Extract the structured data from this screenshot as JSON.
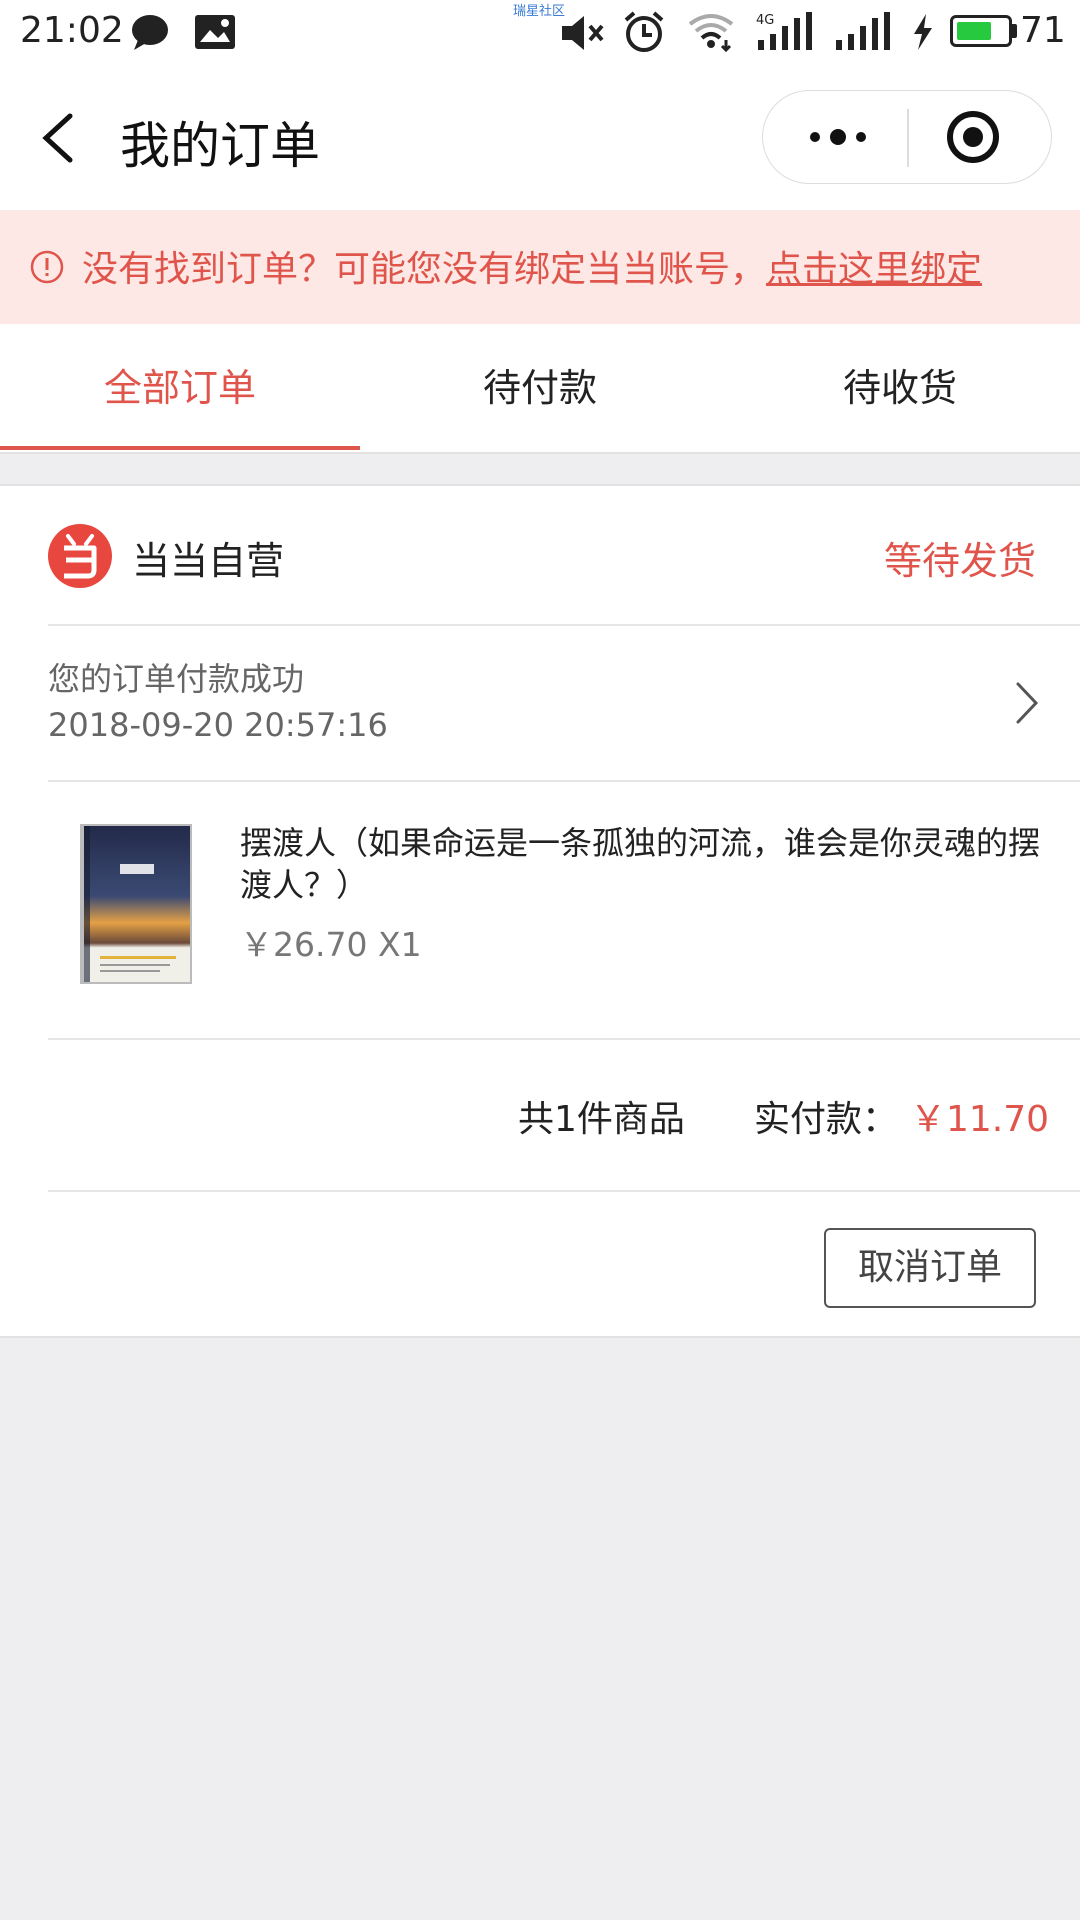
{
  "status_bar": {
    "time": "21:02",
    "watermark": "瑞星社区",
    "battery_percent": "71",
    "battery_level": 0.71,
    "icons": [
      "message-icon",
      "image-icon",
      "mute-icon",
      "alarm-icon",
      "wifi-icon",
      "signal-4g-icon",
      "signal-icon",
      "charging-icon",
      "battery-icon"
    ]
  },
  "nav": {
    "title": "我的订单",
    "back_icon": "chevron-left-icon",
    "more_icon": "more-dots-icon",
    "close_icon": "target-close-icon"
  },
  "notice": {
    "text": "没有找到订单？可能您没有绑定当当账号，",
    "link": "点击这里绑定",
    "icon": "alert-circle-icon"
  },
  "tabs": [
    {
      "label": "全部订单",
      "active": true
    },
    {
      "label": "待付款",
      "active": false
    },
    {
      "label": "待收货",
      "active": false
    }
  ],
  "order": {
    "shop_name": "当当自营",
    "status": "等待发货",
    "pay_message": "您的订单付款成功",
    "pay_time": "2018-09-20 20:57:16",
    "items": [
      {
        "title": "摆渡人（如果命运是一条孤独的河流，谁会是你灵魂的摆渡人？）",
        "price_qty": "￥26.70 X1"
      }
    ],
    "count_label": "共1件商品",
    "paid_label": "实付款：",
    "paid_amount": "￥11.70",
    "cancel_label": "取消订单"
  },
  "colors": {
    "accent": "#e0554b",
    "notice_bg": "#fde8e5",
    "page_bg": "#eeeef0"
  }
}
